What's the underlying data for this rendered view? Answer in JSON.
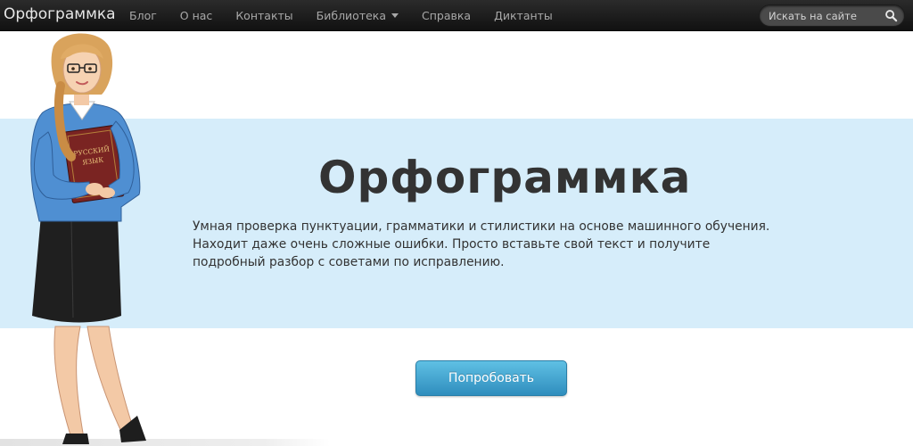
{
  "navbar": {
    "brand": "Орфограммка",
    "items": [
      {
        "label": "Блог"
      },
      {
        "label": "О нас"
      },
      {
        "label": "Контакты"
      },
      {
        "label": "Библиотека"
      },
      {
        "label": "Справка"
      },
      {
        "label": "Диктанты"
      }
    ],
    "search": {
      "placeholder": "Искать на сайте",
      "icon": "search-icon"
    }
  },
  "hero": {
    "title": "Орфограммка",
    "text": "Умная проверка пунктуации, грамматики и стилистики на основе машинного обучения. Находит даже очень сложные ошибки. Просто вставьте свой текст и получите подробный разбор с советами по исправлению."
  },
  "cta": {
    "label": "Попробовать"
  },
  "illustration": {
    "book_title": "РУССКИЙ ЯЗЫК"
  },
  "colors": {
    "navbar": "#1c1c1c",
    "hero_background": "#d6edfa",
    "button": "#3fa3d2",
    "text": "#333333"
  }
}
